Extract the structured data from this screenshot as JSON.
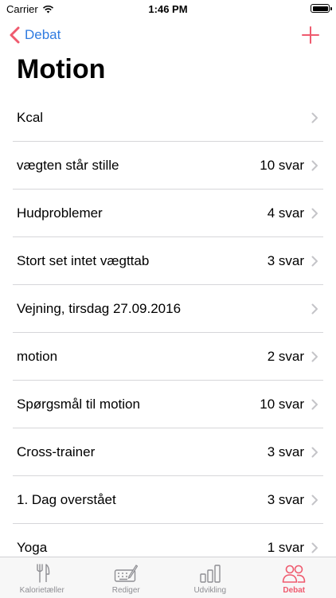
{
  "status_bar": {
    "carrier": "Carrier",
    "time": "1:46 PM"
  },
  "nav": {
    "back_label": "Debat",
    "add_icon": "plus-icon",
    "accent_color": "#ef5a6e",
    "link_color": "#2f7be0"
  },
  "page": {
    "title": "Motion"
  },
  "topics": [
    {
      "title": "Kcal",
      "count": ""
    },
    {
      "title": "vægten står stille",
      "count": "10 svar"
    },
    {
      "title": "Hudproblemer",
      "count": "4 svar"
    },
    {
      "title": "Stort set intet vægttab",
      "count": "3 svar"
    },
    {
      "title": "Vejning, tirsdag 27.09.2016",
      "count": ""
    },
    {
      "title": "motion",
      "count": "2 svar"
    },
    {
      "title": "Spørgsmål til motion",
      "count": "10 svar"
    },
    {
      "title": "Cross-trainer",
      "count": "3 svar"
    },
    {
      "title": "1. Dag overstået",
      "count": "3 svar"
    },
    {
      "title": "Yoga",
      "count": "1 svar"
    }
  ],
  "tab_bar": {
    "tabs": [
      {
        "label": "Kalorietæller",
        "icon": "fork-knife-icon"
      },
      {
        "label": "Rediger",
        "icon": "keyboard-pen-icon"
      },
      {
        "label": "Udvikling",
        "icon": "bar-chart-icon"
      },
      {
        "label": "Debat",
        "icon": "people-icon",
        "active": true
      }
    ]
  }
}
